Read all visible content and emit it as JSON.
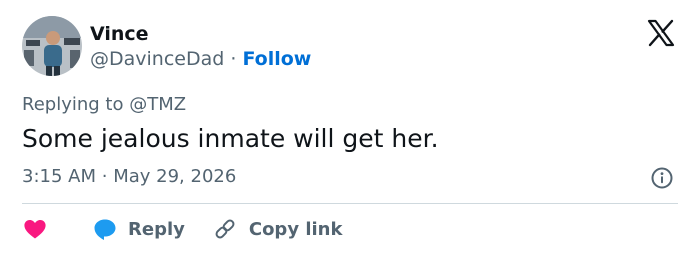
{
  "author": {
    "display_name": "Vince",
    "handle": "@DavinceDad",
    "separator": "·",
    "follow_label": "Follow"
  },
  "reply_context": {
    "prefix": "Replying to",
    "handle": "@TMZ"
  },
  "tweet": {
    "text": "Some jealous inmate will get her.",
    "time": "3:15 AM",
    "separator": "·",
    "date": "May 29, 2026"
  },
  "actions": {
    "reply_label": "Reply",
    "copy_label": "Copy link"
  },
  "colors": {
    "link_blue": "#006fd6",
    "muted_text": "#536471",
    "heart_red": "#f91880",
    "bubble_blue": "#1d9bf0"
  },
  "icons": {
    "brand": "x-logo-icon",
    "info": "info-icon",
    "like": "heart-icon",
    "reply": "speech-bubble-icon",
    "copy": "link-icon"
  }
}
